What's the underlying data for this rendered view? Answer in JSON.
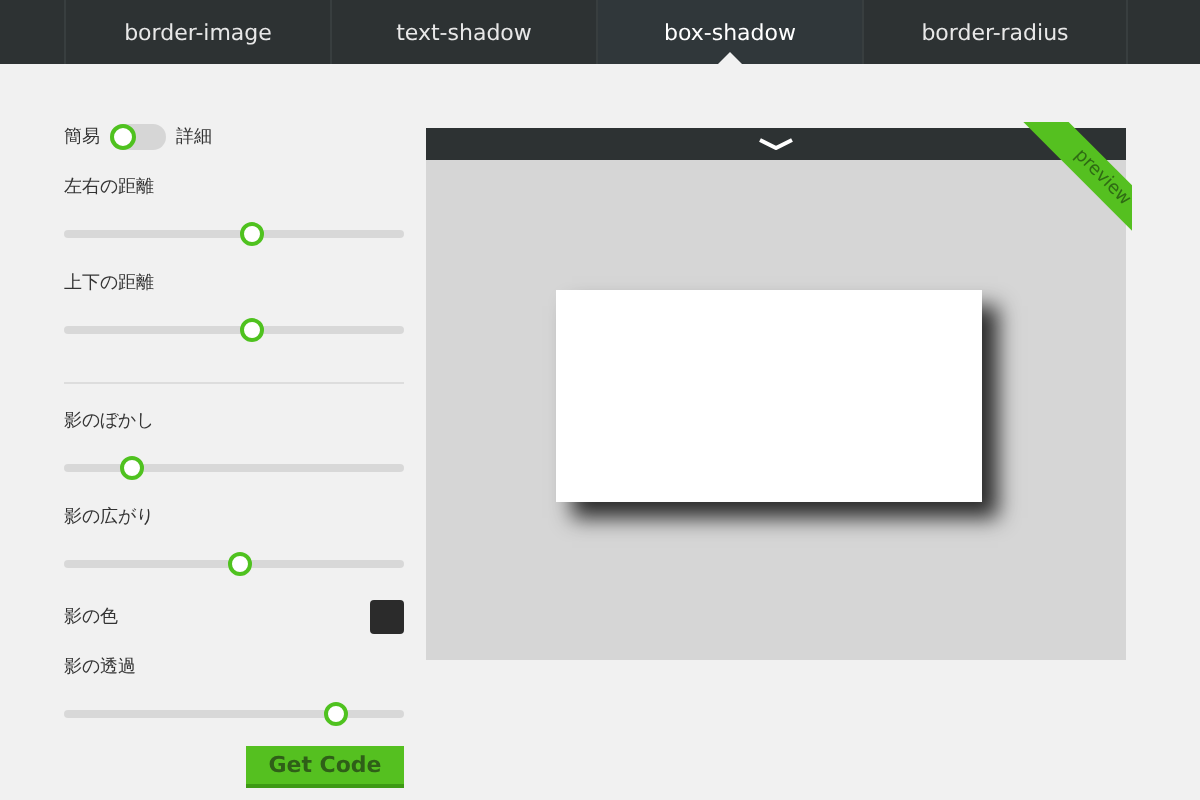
{
  "tabs": [
    {
      "label": "border-image",
      "selected": false
    },
    {
      "label": "text-shadow",
      "selected": false
    },
    {
      "label": "box-shadow",
      "selected": true
    },
    {
      "label": "border-radius",
      "selected": false
    }
  ],
  "mode_toggle": {
    "left_label": "簡易",
    "right_label": "詳細",
    "on": false
  },
  "control_groups": [
    {
      "controls": [
        {
          "kind": "slider",
          "label": "左右の距離",
          "level": 0.55
        },
        {
          "kind": "slider",
          "label": "上下の距離",
          "level": 0.55
        }
      ]
    },
    {
      "controls": [
        {
          "kind": "slider",
          "label": "影のぼかし",
          "level": 0.2
        },
        {
          "kind": "slider",
          "label": "影の広がり",
          "level": 0.52
        },
        {
          "kind": "color",
          "label": "影の色",
          "color": "#2b2b2b"
        },
        {
          "kind": "slider",
          "label": "影の透過",
          "level": 0.8
        }
      ]
    }
  ],
  "get_code_button": "Get Code",
  "preview": {
    "ribbon": "preview"
  }
}
